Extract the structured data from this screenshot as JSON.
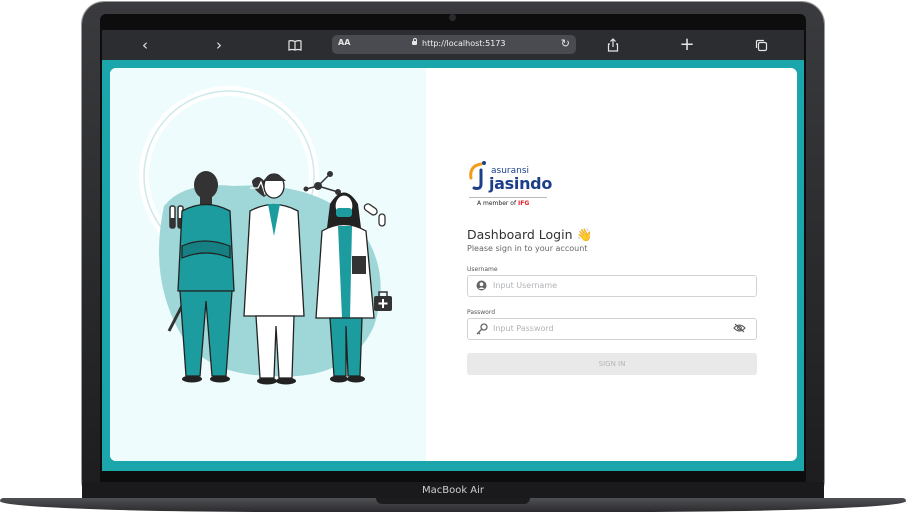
{
  "browser": {
    "aa_label": "AA",
    "url": "http://localhost:5173",
    "icons": [
      "back-icon",
      "forward-icon",
      "bookmarks-icon",
      "reload-icon",
      "share-icon",
      "new-tab-icon",
      "tabs-icon"
    ]
  },
  "brand": {
    "logo_small": "asuransi",
    "logo_big": "jasindo",
    "member_prefix": "A member of",
    "member_brand": "IFG"
  },
  "login": {
    "title": "Dashboard Login 👋",
    "subtitle": "Please sign in to your account",
    "username_label": "Username",
    "username_placeholder": "Input Username",
    "password_label": "Password",
    "password_placeholder": "Input Password",
    "signin_label": "SIGN IN"
  },
  "device": {
    "label": "MacBook Air"
  },
  "colors": {
    "teal_bg": "#1aa6aa",
    "left_panel": "#effcfd",
    "scrub": "#1c9c9e"
  }
}
